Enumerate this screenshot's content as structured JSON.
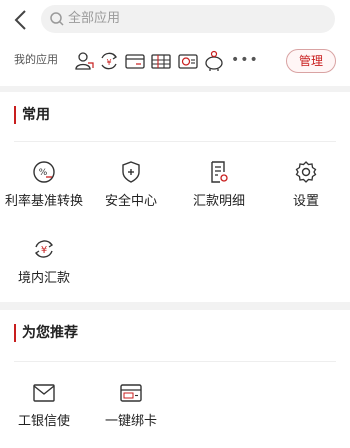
{
  "header": {
    "search_placeholder": "全部应用"
  },
  "my_apps": {
    "label": "我的应用",
    "icons": [
      "person-icon",
      "yuan-exchange-icon",
      "card-icon",
      "passbook-icon",
      "fund-chart-icon",
      "piggy-bank-icon"
    ],
    "more": "•••",
    "manage_label": "管理"
  },
  "common": {
    "title": "常用",
    "items": [
      {
        "label": "利率基准转换",
        "icon": "percent-exchange-icon"
      },
      {
        "label": "安全中心",
        "icon": "shield-plus-icon"
      },
      {
        "label": "汇款明细",
        "icon": "document-list-icon"
      },
      {
        "label": "设置",
        "icon": "gear-icon"
      },
      {
        "label": "境内汇款",
        "icon": "yuan-transfer-icon"
      }
    ]
  },
  "recommended": {
    "title": "为您推荐",
    "items": [
      {
        "label": "工银信使",
        "icon": "envelope-icon"
      },
      {
        "label": "一键绑卡",
        "icon": "pay-card-icon"
      }
    ]
  },
  "colors": {
    "accent": "#c81e1e",
    "background": "#f2f2f2",
    "text": "#222222"
  }
}
